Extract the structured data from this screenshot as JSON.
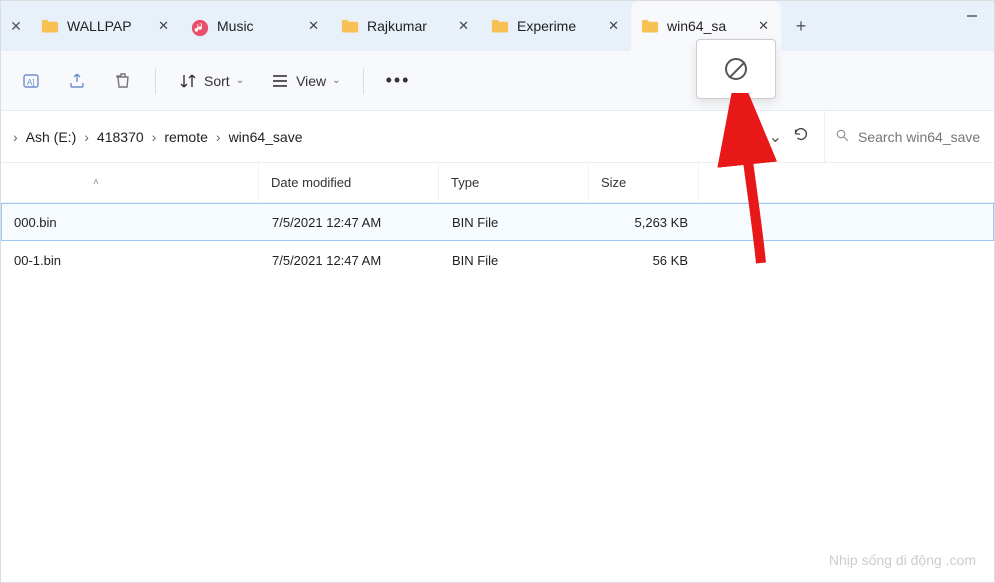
{
  "tabs": [
    {
      "label": "WALLPAP",
      "icon": "folder"
    },
    {
      "label": "Music",
      "icon": "music"
    },
    {
      "label": "Rajkumar",
      "icon": "folder"
    },
    {
      "label": "Experime",
      "icon": "folder"
    },
    {
      "label": "win64_sa",
      "icon": "folder",
      "active": true
    }
  ],
  "toolbar": {
    "sort_label": "Sort",
    "view_label": "View"
  },
  "breadcrumb": [
    "Ash (E:)",
    "418370",
    "remote",
    "win64_save"
  ],
  "search": {
    "placeholder": "Search win64_save"
  },
  "columns": {
    "name": "",
    "date": "Date modified",
    "type": "Type",
    "size": "Size"
  },
  "files": [
    {
      "name": "000.bin",
      "date": "7/5/2021 12:47 AM",
      "type": "BIN File",
      "size": "5,263 KB",
      "selected": true
    },
    {
      "name": "00-1.bin",
      "date": "7/5/2021 12:47 AM",
      "type": "BIN File",
      "size": "56 KB",
      "selected": false
    }
  ],
  "watermark": "Nhịp sống di động .com"
}
